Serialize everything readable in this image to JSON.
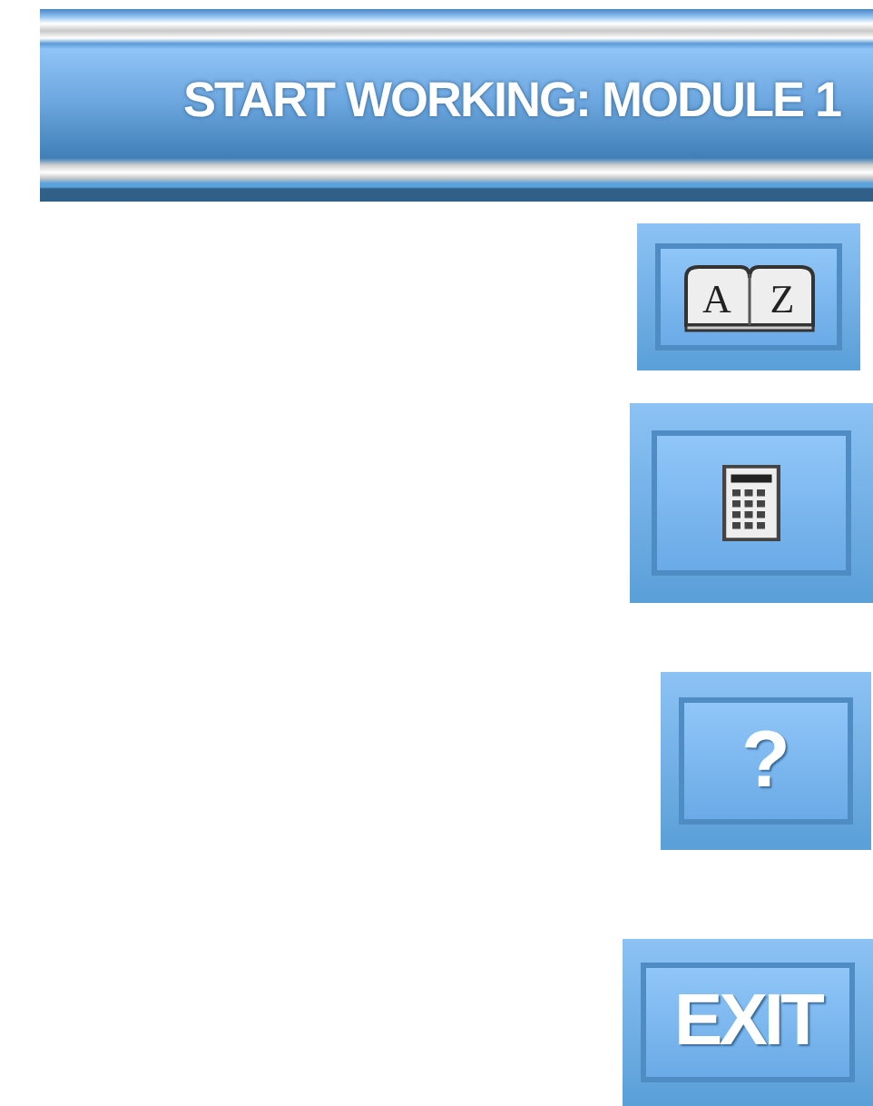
{
  "header": {
    "title": "START WORKING: MODULE 1"
  },
  "buttons": [
    {
      "kind": "glossary",
      "letters": [
        "A",
        "Z"
      ]
    },
    {
      "kind": "calculator"
    },
    {
      "kind": "help",
      "label": "?"
    },
    {
      "kind": "exit",
      "label": "EXIT"
    }
  ]
}
